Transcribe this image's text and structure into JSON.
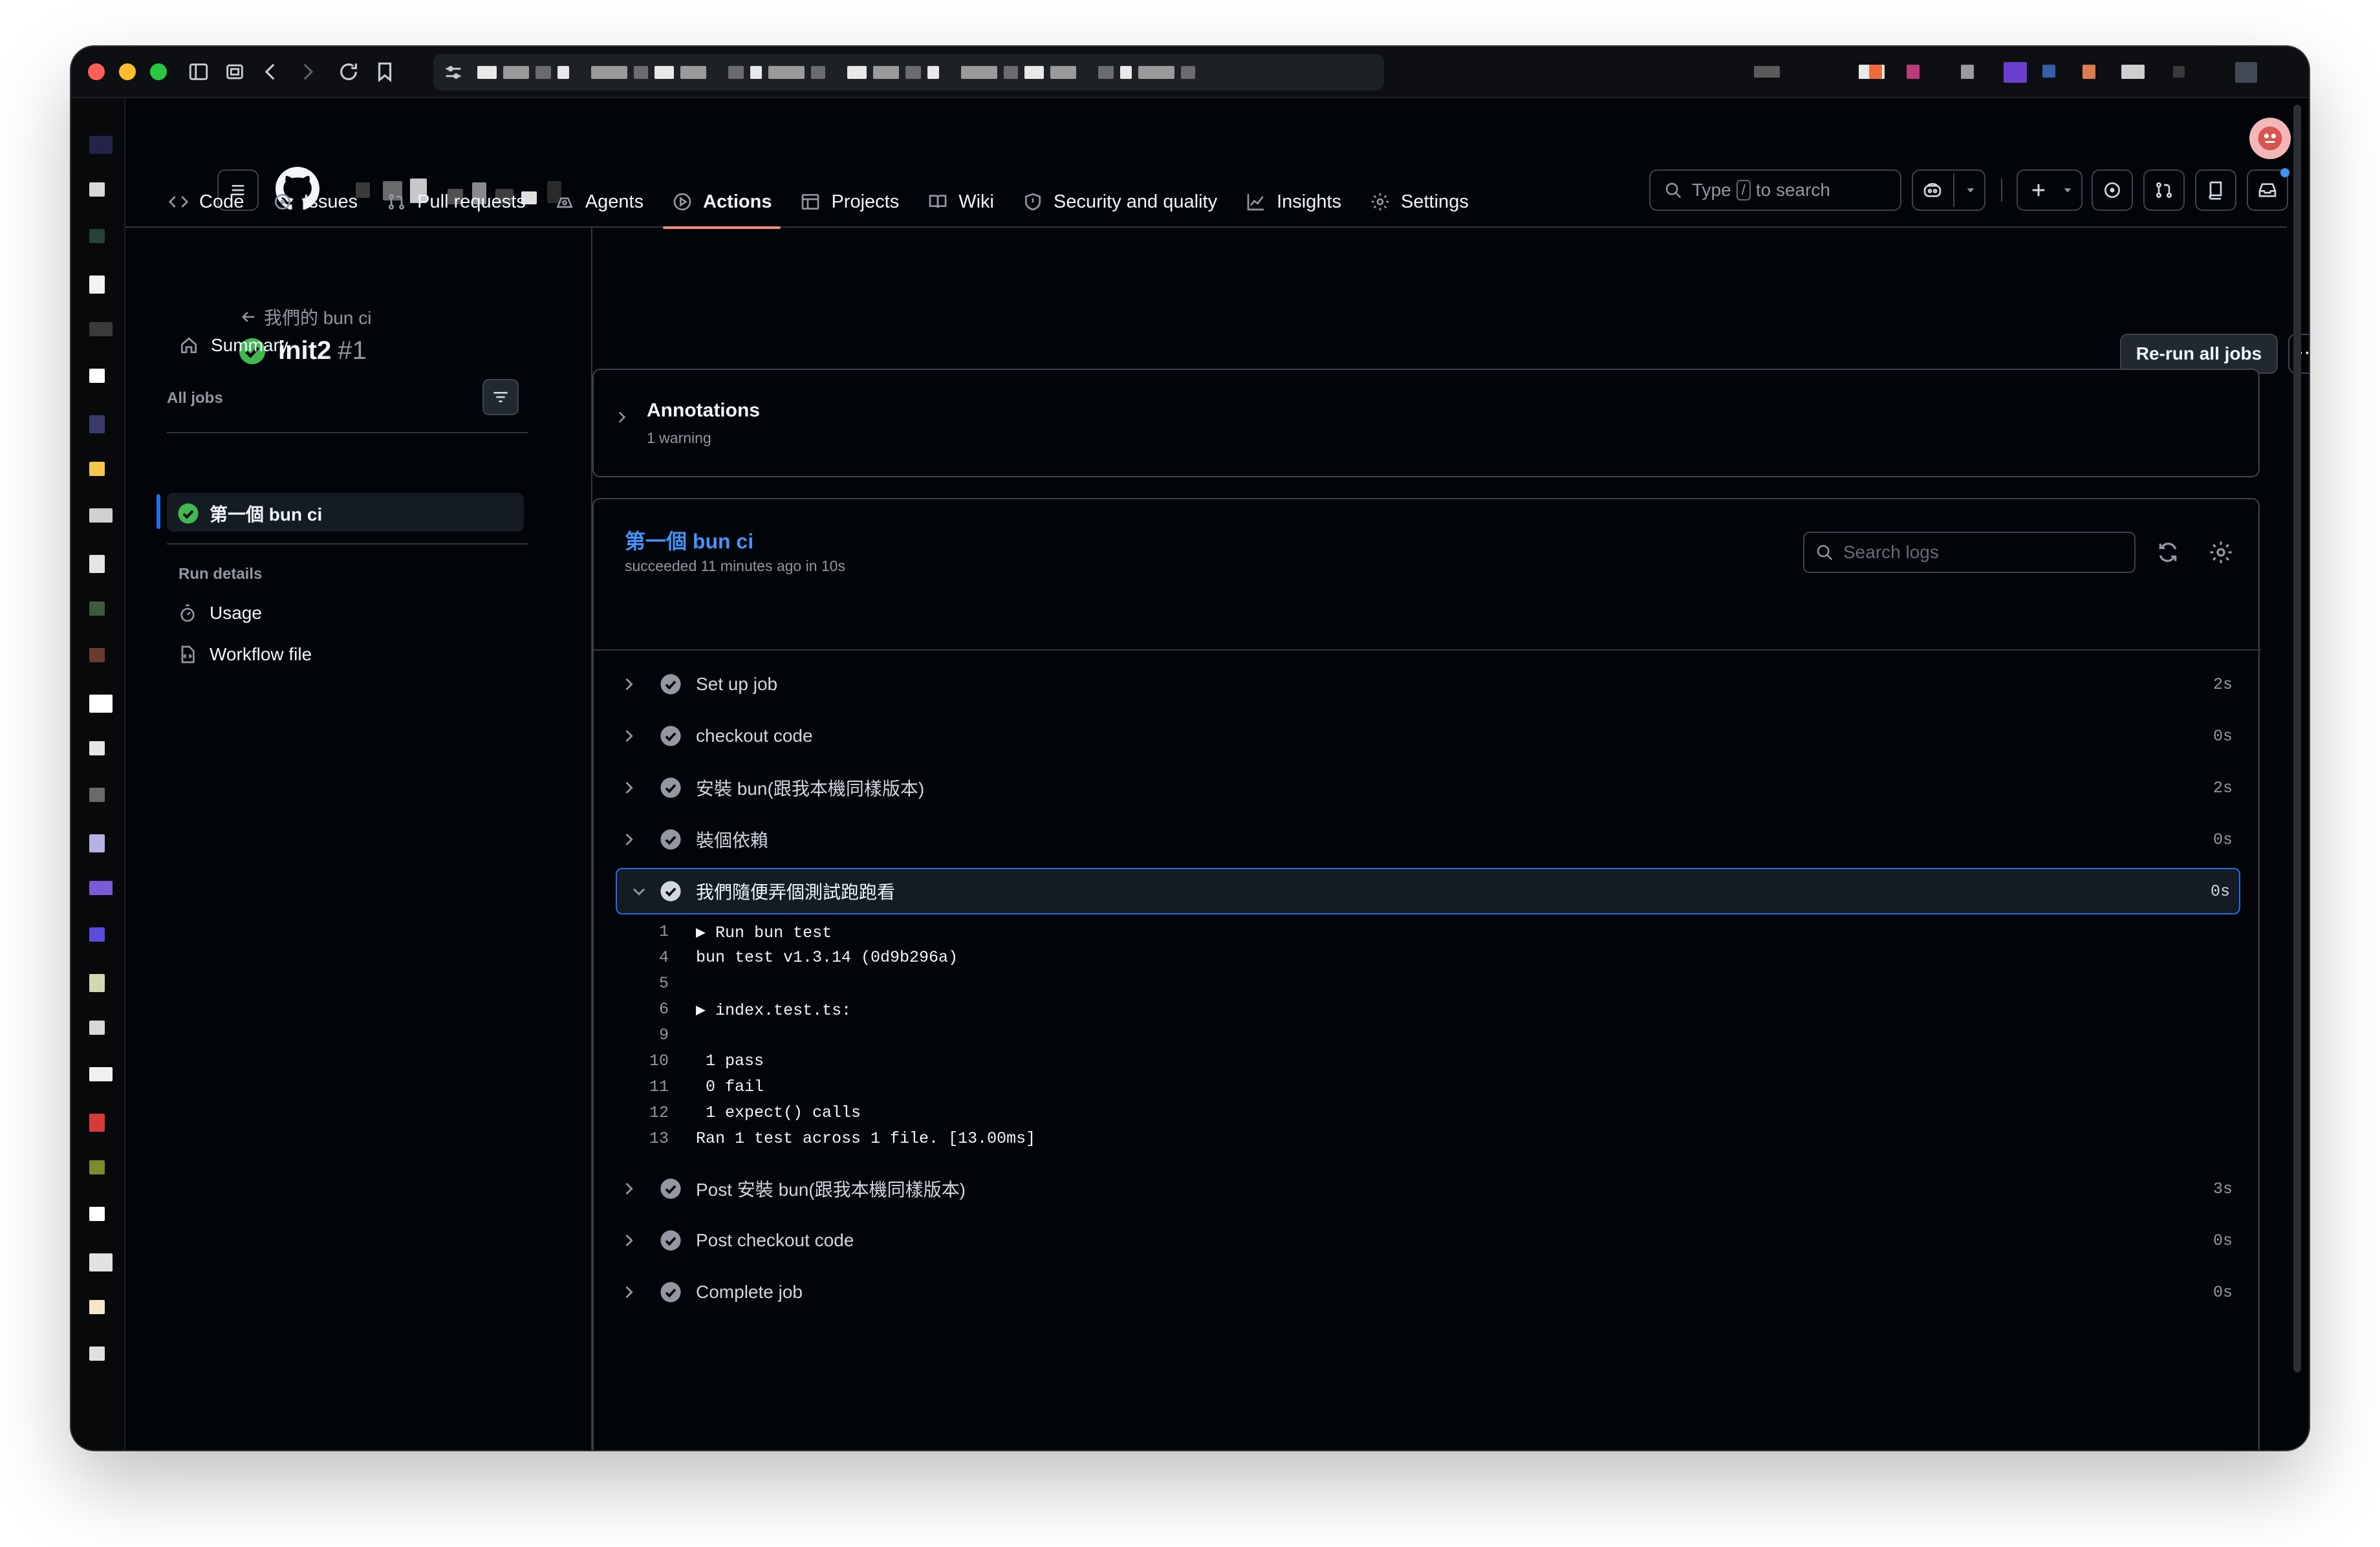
{
  "browser": {
    "url_blocks": 24
  },
  "header": {
    "search_prefix": "Type",
    "search_key": "/",
    "search_suffix": "to search",
    "icons": [
      "menu-icon",
      "github-logo",
      "copilot-icon",
      "plus-icon",
      "issue-icon",
      "pull-request-icon",
      "repo-icon",
      "inbox-icon"
    ]
  },
  "nav": {
    "tabs": [
      {
        "label": "Code",
        "icon": "code-icon"
      },
      {
        "label": "Issues",
        "icon": "issue-icon"
      },
      {
        "label": "Pull requests",
        "icon": "pull-request-icon"
      },
      {
        "label": "Agents",
        "icon": "agent-icon"
      },
      {
        "label": "Actions",
        "icon": "play-icon",
        "active": true
      },
      {
        "label": "Projects",
        "icon": "table-icon"
      },
      {
        "label": "Wiki",
        "icon": "book-icon"
      },
      {
        "label": "Security and quality",
        "icon": "shield-icon"
      },
      {
        "label": "Insights",
        "icon": "graph-icon"
      },
      {
        "label": "Settings",
        "icon": "gear-icon"
      }
    ]
  },
  "run": {
    "back_label": "我們的 bun ci",
    "title": "init2",
    "number": "#1",
    "rerun_label": "Re-run all jobs",
    "more_label": "···"
  },
  "sidebar": {
    "summary": "Summary",
    "all_jobs": "All jobs",
    "job": "第一個 bun ci",
    "run_details": "Run details",
    "usage": "Usage",
    "workflow_file": "Workflow file"
  },
  "annotations": {
    "title": "Annotations",
    "subtitle": "1 warning"
  },
  "job": {
    "name": "第一個 bun ci",
    "status": "succeeded 11 minutes ago in 10s",
    "search_placeholder": "Search logs",
    "steps": [
      {
        "label": "Set up job",
        "duration": "2s"
      },
      {
        "label": "checkout code",
        "duration": "0s"
      },
      {
        "label": "安裝 bun(跟我本機同樣版本)",
        "duration": "2s"
      },
      {
        "label": "裝個依賴",
        "duration": "0s"
      },
      {
        "label": "我們隨便弄個測試跑跑看",
        "duration": "0s",
        "expanded": true
      },
      {
        "label": "Post 安裝 bun(跟我本機同樣版本)",
        "duration": "3s"
      },
      {
        "label": "Post checkout code",
        "duration": "0s"
      },
      {
        "label": "Complete job",
        "duration": "0s"
      }
    ],
    "log": [
      {
        "n": "1",
        "t": "▶ Run bun test"
      },
      {
        "n": "4",
        "t": "bun test v1.3.14 (0d9b296a)"
      },
      {
        "n": "5",
        "t": ""
      },
      {
        "n": "6",
        "t": "▶ index.test.ts:"
      },
      {
        "n": "9",
        "t": ""
      },
      {
        "n": "10",
        "t": " 1 pass"
      },
      {
        "n": "11",
        "t": " 0 fail"
      },
      {
        "n": "12",
        "t": " 1 expect() calls"
      },
      {
        "n": "13",
        "t": "Ran 1 test across 1 file. [13.00ms]"
      }
    ]
  },
  "colors": {
    "success": "#3fb950",
    "accent": "#4493f8",
    "active_tab": "#fd8c73",
    "bg": "#010409",
    "border": "#3d444d"
  }
}
